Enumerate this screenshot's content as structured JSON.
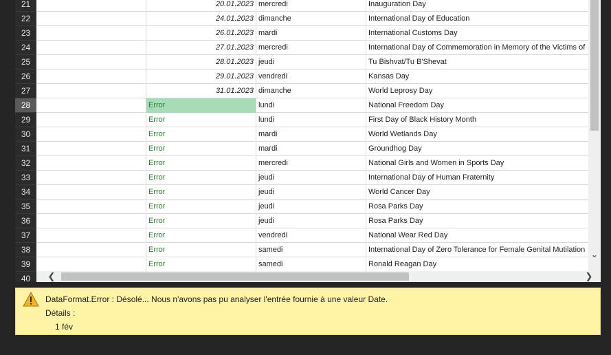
{
  "rows": [
    {
      "num": "21",
      "date": "20.01.2023",
      "day": "mercredi",
      "event": "Inauguration Day",
      "error": false
    },
    {
      "num": "22",
      "date": "24.01.2023",
      "day": "dimanche",
      "event": "International Day of Education",
      "error": false
    },
    {
      "num": "23",
      "date": "26.01.2023",
      "day": "mardi",
      "event": "International Customs Day",
      "error": false
    },
    {
      "num": "24",
      "date": "27.01.2023",
      "day": "mercredi",
      "event": "International Day of Commemoration in Memory of the Victims of",
      "error": false
    },
    {
      "num": "25",
      "date": "28.01.2023",
      "day": "jeudi",
      "event": "Tu Bishvat/Tu B'Shevat",
      "error": false
    },
    {
      "num": "26",
      "date": "29.01.2023",
      "day": "vendredi",
      "event": "Kansas Day",
      "error": false
    },
    {
      "num": "27",
      "date": "31.01.2023",
      "day": "dimanche",
      "event": "World Leprosy Day",
      "error": false
    },
    {
      "num": "28",
      "date": "Error",
      "day": "lundi",
      "event": "National Freedom Day",
      "error": true,
      "selected": true
    },
    {
      "num": "29",
      "date": "Error",
      "day": "lundi",
      "event": "First Day of Black History Month",
      "error": true
    },
    {
      "num": "30",
      "date": "Error",
      "day": "mardi",
      "event": "World Wetlands Day",
      "error": true
    },
    {
      "num": "31",
      "date": "Error",
      "day": "mardi",
      "event": "Groundhog Day",
      "error": true
    },
    {
      "num": "32",
      "date": "Error",
      "day": "mercredi",
      "event": "National Girls and Women in Sports Day",
      "error": true
    },
    {
      "num": "33",
      "date": "Error",
      "day": "jeudi",
      "event": "International Day of Human Fraternity",
      "error": true
    },
    {
      "num": "34",
      "date": "Error",
      "day": "jeudi",
      "event": "World Cancer Day",
      "error": true
    },
    {
      "num": "35",
      "date": "Error",
      "day": "jeudi",
      "event": "Rosa Parks Day",
      "error": true
    },
    {
      "num": "36",
      "date": "Error",
      "day": "jeudi",
      "event": "Rosa Parks Day",
      "error": true
    },
    {
      "num": "37",
      "date": "Error",
      "day": "vendredi",
      "event": "National Wear Red Day",
      "error": true
    },
    {
      "num": "38",
      "date": "Error",
      "day": "samedi",
      "event": "International Day of Zero Tolerance for Female Genital Mutilation",
      "error": true
    },
    {
      "num": "39",
      "date": "Error",
      "day": "samedi",
      "event": "Ronald Reagan Day",
      "error": true
    }
  ],
  "last_row_num": "40",
  "error_panel": {
    "message": "DataFormat.Error : Désolé... Nous n'avons pas pu analyser l'entrée fournie à une valeur Date.",
    "details_label": "Détails :",
    "details_value": "1 fév",
    "icon": "warning-icon",
    "background": "#fff3a6"
  },
  "colors": {
    "error_text": "#2e7d32",
    "selected_cell": "#a6dcb8"
  }
}
